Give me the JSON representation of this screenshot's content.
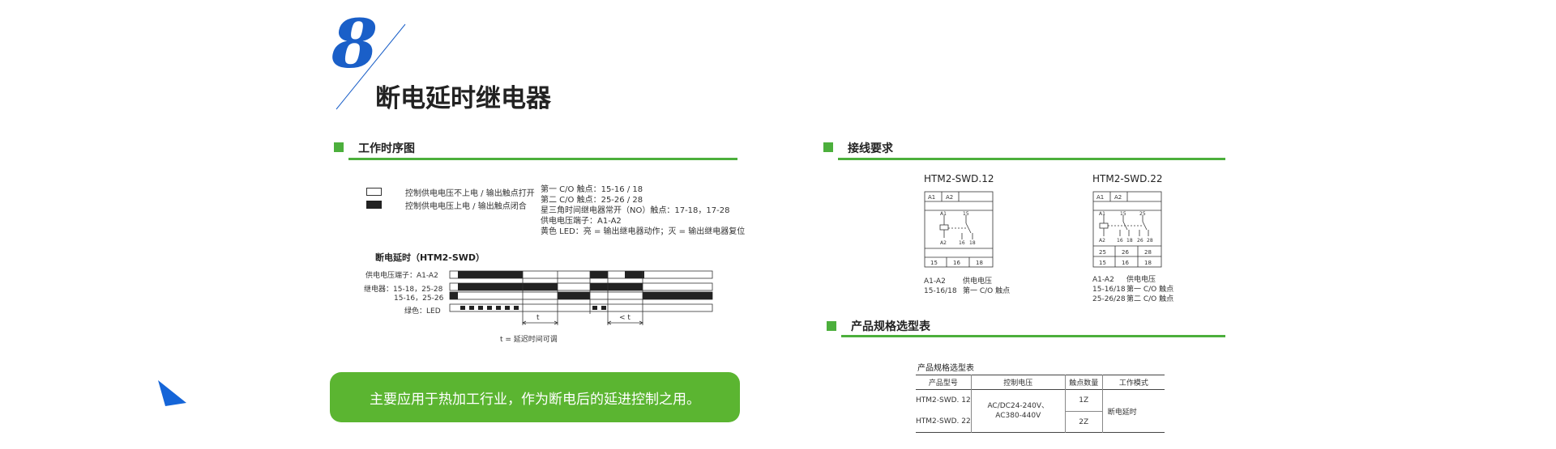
{
  "header": {
    "number": "8",
    "title": "断电延时继电器"
  },
  "timing": {
    "section_title": "工作时序图",
    "legend_open": "控制供电电压不上电 / 输出触点打开",
    "legend_closed": "控制供电电压上电 / 输出触点闭合",
    "notes": [
      "第一 C/O 触点：15-16 / 18",
      "第二 C/O 触点：25-26 / 28",
      "星三角时间继电器常开（NO）触点：17-18，17-28",
      "供电电压端子：A1-A2",
      "黄色 LED：亮 = 输出继电器动作；灭 = 输出继电器复位"
    ],
    "diagram_title": "断电延时（HTM2-SWD）",
    "row_supply": "供电电压端子：A1-A2",
    "row_relay_1": "继电器：15-18，25-28",
    "row_relay_2": "15-16，25-26",
    "row_led": "绿色：LED",
    "t_label": "t",
    "lt_label": "< t",
    "t_note": "t = 延迟时间可调"
  },
  "wiring": {
    "section_title": "接线要求",
    "models": [
      {
        "name": "HTM2-SWD.12",
        "top_terms": [
          "A1",
          "A2"
        ],
        "bottom_rows": [
          [
            "15",
            "16",
            "18"
          ]
        ],
        "inner_labels": [
          "A1",
          "15",
          "A2",
          "16",
          "18"
        ],
        "legend": [
          {
            "code": "A1-A2",
            "desc": "供电电压"
          },
          {
            "code": "15-16/18",
            "desc": "第一 C/O 触点"
          }
        ]
      },
      {
        "name": "HTM2-SWD.22",
        "top_terms": [
          "A1",
          "A2"
        ],
        "bottom_rows": [
          [
            "25",
            "26",
            "28"
          ],
          [
            "15",
            "16",
            "18"
          ]
        ],
        "inner_labels": [
          "A1",
          "15",
          "25",
          "A2",
          "16",
          "18",
          "26",
          "28"
        ],
        "legend": [
          {
            "code": "A1-A2",
            "desc": "供电电压"
          },
          {
            "code": "15-16/18",
            "desc": "第一 C/O 触点"
          },
          {
            "code": "25-26/28",
            "desc": "第二 C/O 触点"
          }
        ]
      }
    ]
  },
  "spec": {
    "section_title": "产品规格选型表",
    "table_title": "产品规格选型表",
    "headers": [
      "产品型号",
      "控制电压",
      "触点数量",
      "工作模式"
    ],
    "rows": [
      {
        "model": "HTM2-SWD. 12",
        "contacts": "1Z"
      },
      {
        "model": "HTM2-SWD. 22",
        "contacts": "2Z"
      }
    ],
    "voltage_line1": "AC/DC24-240V、",
    "voltage_line2": "AC380-440V",
    "mode": "断电延时"
  },
  "banner": {
    "text": "主要应用于热加工行业，作为断电后的延进控制之用。"
  },
  "colors": {
    "accent_green": "#4caf3c",
    "banner_green": "#5bb531",
    "number_blue": "#1a5fc8",
    "corner_blue": "#1565d8"
  }
}
